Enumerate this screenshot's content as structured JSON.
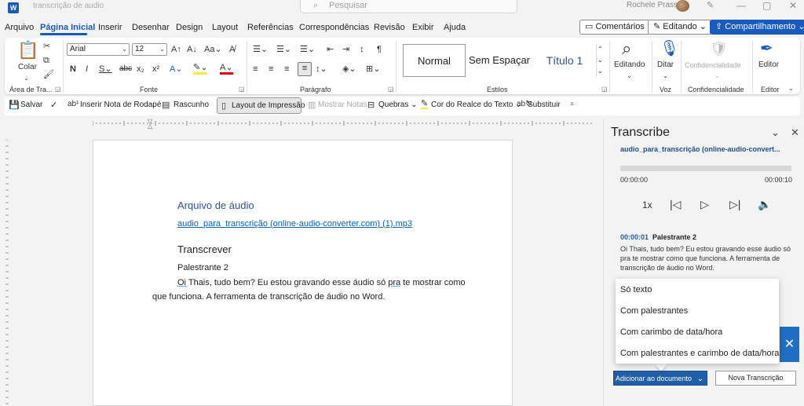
{
  "titlebar": {
    "app_icon": "W",
    "doc_title": "transcrição de audio",
    "search_placeholder": "Pesquisar",
    "user_name": "Rochele Prass",
    "minimize_icon": "—",
    "restore_icon": "▢",
    "close_icon": "✕"
  },
  "menu_tabs": [
    "Arquivo",
    "Página Inicial",
    "Inserir",
    "Desenhar",
    "Design",
    "Layout",
    "Referências",
    "Correspondências",
    "Revisão",
    "Exibir",
    "Ajuda"
  ],
  "top_buttons": {
    "comments": "Comentários",
    "editing": "Editando",
    "share": "Compartilhamento"
  },
  "ribbon": {
    "paste_label": "Colar",
    "clipboard_label": "Área de Tra...",
    "font_group": "Fonte",
    "font_name": "Arial",
    "font_size": "12",
    "paragraph_group": "Parágrafo",
    "styles_group": "Estilos",
    "styles": [
      "Normal",
      "Sem Espaçar",
      "Título 1"
    ],
    "editing_label": "Editando",
    "dictate_label": "Ditar",
    "voice_group": "Voz",
    "sensitivity_label": "Confidencialidade",
    "sensitivity_group": "Confidencialidade",
    "editor_label": "Editor",
    "editor_group": "Editor"
  },
  "quick_access": {
    "save": "Salvar",
    "footnote": "Inserir Nota de Rodapé",
    "draft": "Rascunho",
    "print_layout": "Layout de Impressão",
    "show_notes": "Mostrar Notas",
    "breaks": "Quebras",
    "highlight": "Cor do Realce do Texto",
    "replace": "Substituir"
  },
  "document": {
    "heading": "Arquivo de áudio",
    "link": "audio_para_transcrição (online-audio-converter.com) (1).mp3",
    "transcribe_heading": "Transcrever",
    "speaker": "Palestrante 2",
    "line1_word": "Oi",
    "line1_mid": " Thais, tudo bem? Eu estou gravando esse áudio só ",
    "line1_word2": "pra",
    "line1_end": " te mostrar como",
    "line2": "que funciona. A ferramenta de transcrição de áudio no Word."
  },
  "panel": {
    "title": "Transcribe",
    "file_name": "audio_para_transcrição (online-audio-convert...",
    "time_start": "00:00:00",
    "time_end": "00:00:10",
    "speed": "1x",
    "progress": 0,
    "entry_time": "00:00:01",
    "entry_speaker": "Palestrante 2",
    "entry_text_1": "Oi Thais, tudo bem? Eu estou gravando esse áudio só",
    "entry_text_2": "pra te mostrar como que funciona. A ferramenta de",
    "entry_text_3": "transcrição de áudio no Word.",
    "menu_items": [
      "Só texto",
      "Com palestrantes",
      "Com carimbo de data/hora",
      "Com palestrantes e carimbo de data/hora"
    ],
    "add_button": "Adicionar ao documento",
    "new_button": "Nova Transcrição"
  },
  "colors": {
    "accent": "#185abd",
    "link": "#0563c1",
    "heading": "#2f5496"
  }
}
